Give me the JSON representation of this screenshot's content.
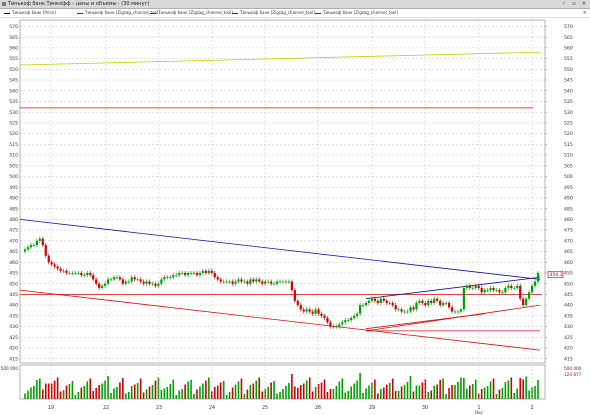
{
  "window": {
    "title": "Тинькоф банк Тинкофф - цены и объемы - (30 минут)",
    "buttons": {
      "pin": "✓",
      "restore": "▫",
      "close": "✕"
    }
  },
  "legend": [
    {
      "label": "Тинькоф банк [Price]",
      "color": "#000000"
    },
    {
      "label": "Тинькоф банк [Zigzag_channel_tool]",
      "color": "#c00000"
    },
    {
      "label": "Тинькоф банк [Zigzag_channel_tool]",
      "color": "#c00000"
    },
    {
      "label": "Тинькоф банк [Zigzag_channel_tool]",
      "color": "#c00000"
    },
    {
      "label": "Тинькоф банк [Zigzag_channel_tool]",
      "color": "#c00000"
    }
  ],
  "colors": {
    "up": "#00a000",
    "down": "#d00000",
    "blue_line": "#1010a0",
    "red_line": "#d01010",
    "yellow_line": "#c8c800",
    "grid": "#c0c0c0"
  },
  "chart_data": {
    "type": "candlestick",
    "ylim": [
      413,
      573
    ],
    "price_ticks": [
      "570",
      "565",
      "560",
      "555",
      "550",
      "545",
      "540",
      "535",
      "530",
      "525",
      "520",
      "515",
      "510",
      "505",
      "500",
      "495",
      "490",
      "485",
      "480",
      "475",
      "470",
      "465",
      "460",
      "455",
      "450",
      "445",
      "440",
      "435",
      "430",
      "425",
      "420",
      "415"
    ],
    "current_price": "454.3",
    "x_labels": [
      "19",
      "22",
      "23",
      "24",
      "25",
      "26",
      "29",
      "30",
      "1",
      "2"
    ],
    "x_sublabel": "Dec",
    "volume_axis_labels": [
      "500 000",
      "124 877"
    ],
    "volume_left_label": "500 000",
    "series_close": [
      466,
      467,
      468,
      468,
      470,
      471,
      468,
      463,
      460,
      459,
      458,
      457,
      456,
      456,
      455,
      455,
      455,
      455,
      455,
      454,
      454,
      455,
      454,
      452,
      450,
      448,
      449,
      450,
      452,
      452,
      453,
      453,
      452,
      450,
      451,
      451,
      453,
      452,
      452,
      451,
      450,
      451,
      450,
      450,
      449,
      450,
      452,
      453,
      453,
      453,
      454,
      454,
      455,
      455,
      454,
      455,
      455,
      455,
      454,
      455,
      456,
      455,
      456,
      455,
      453,
      452,
      451,
      451,
      451,
      451,
      450,
      451,
      452,
      451,
      451,
      450,
      452,
      451,
      452,
      451,
      450,
      451,
      451,
      450,
      450,
      451,
      451,
      451,
      451,
      451,
      447,
      442,
      440,
      438,
      437,
      438,
      437,
      436,
      438,
      436,
      435,
      434,
      432,
      430,
      430,
      430,
      431,
      432,
      433,
      433,
      434,
      435,
      436,
      440,
      440,
      441,
      442,
      443,
      442,
      441,
      443,
      442,
      441,
      441,
      440,
      438,
      438,
      437,
      437,
      437,
      439,
      438,
      441,
      442,
      441,
      440,
      442,
      441,
      443,
      442,
      440,
      441,
      441,
      439,
      437,
      437,
      437,
      438,
      448,
      449,
      448,
      448,
      449,
      448,
      446,
      447,
      447,
      448,
      447,
      447,
      446,
      446,
      448,
      449,
      448,
      448,
      449,
      443,
      440,
      443,
      446,
      449,
      451,
      455
    ],
    "reference_lines": [
      {
        "color": "yellow",
        "from": 552,
        "to": 558
      },
      {
        "color": "red",
        "level": 532
      },
      {
        "color": "red",
        "level": 445
      },
      {
        "color": "red",
        "level": 428
      },
      {
        "color": "blue",
        "from": 480,
        "to": 452
      },
      {
        "color": "red",
        "from": 447,
        "to": 419
      },
      {
        "color": "blue",
        "from": 443,
        "to": 453
      },
      {
        "color": "red",
        "from": 428,
        "to": 440
      }
    ]
  }
}
